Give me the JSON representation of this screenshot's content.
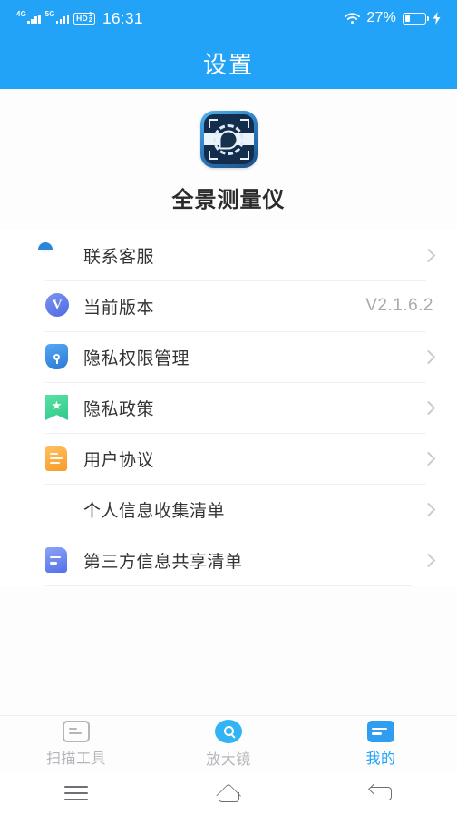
{
  "status_bar": {
    "network_1": "4G",
    "network_2": "5G",
    "hd_label": "HD",
    "hd_sup": "1",
    "hd_sub": "2",
    "time": "16:31",
    "battery_percent": "27%",
    "battery_level": 27,
    "wifi_icon": "wifi-icon",
    "charging_icon": "lightning-bolt-icon"
  },
  "header": {
    "title": "设置"
  },
  "app": {
    "icon_name": "panorama-measure-app-icon",
    "name": "全景测量仪"
  },
  "list": {
    "items": [
      {
        "icon": "headset-support-icon",
        "label": "联系客服",
        "value": "",
        "has_chevron": true
      },
      {
        "icon": "version-badge-icon",
        "label": "当前版本",
        "value": "V2.1.6.2",
        "has_chevron": false
      },
      {
        "icon": "shield-key-icon",
        "label": "隐私权限管理",
        "value": "",
        "has_chevron": true
      },
      {
        "icon": "bookmark-star-icon",
        "label": "隐私政策",
        "value": "",
        "has_chevron": true
      },
      {
        "icon": "document-icon",
        "label": "用户协议",
        "value": "",
        "has_chevron": true
      },
      {
        "icon": "person-card-icon",
        "label": "个人信息收集清单",
        "value": "",
        "has_chevron": true
      },
      {
        "icon": "share-document-icon",
        "label": "第三方信息共享清单",
        "value": "",
        "has_chevron": true
      }
    ]
  },
  "tab_bar": {
    "tabs": [
      {
        "icon": "scan-tool-icon",
        "label": "扫描工具",
        "active": false
      },
      {
        "icon": "magnifier-icon",
        "label": "放大镜",
        "active": false
      },
      {
        "icon": "mine-icon",
        "label": "我的",
        "active": true
      }
    ]
  },
  "nav_bar": {
    "recents_icon": "recents-menu-icon",
    "home_icon": "home-icon",
    "back_icon": "back-icon"
  },
  "colors": {
    "brand_blue": "#22a3f7",
    "accent_tab_active": "#22a3f7",
    "text_primary": "#333333",
    "text_muted": "#a9aaae",
    "divider": "#f0f0f2"
  }
}
